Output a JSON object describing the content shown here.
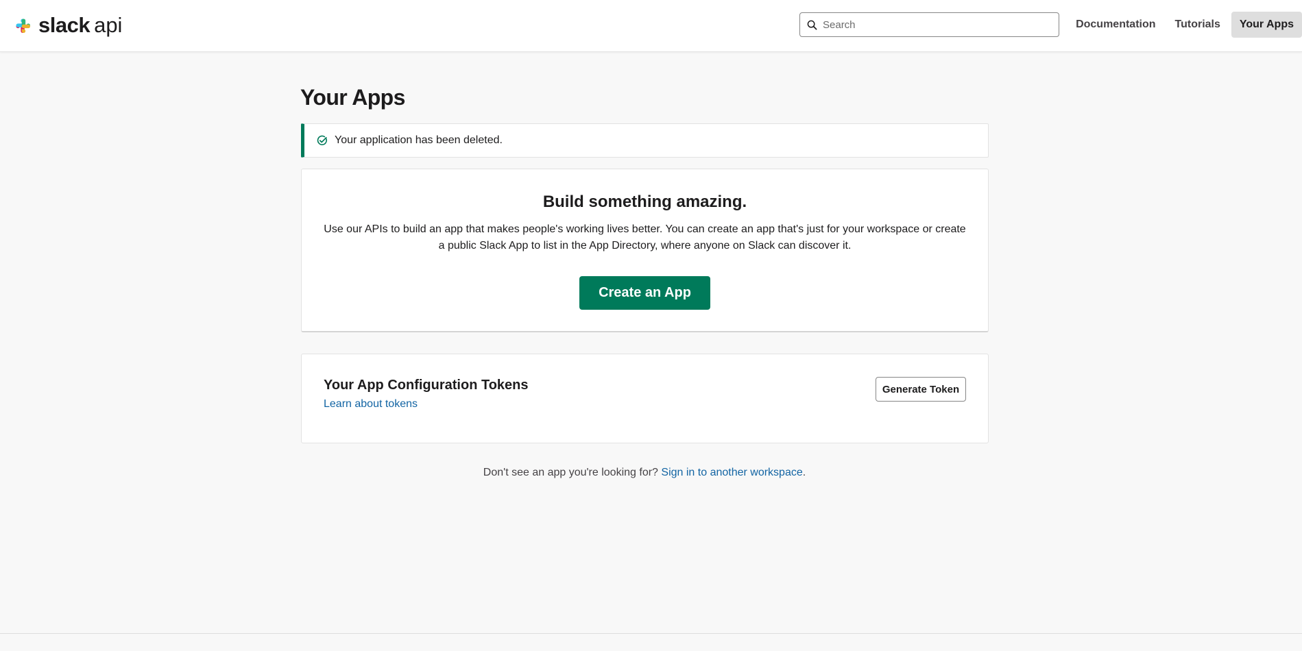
{
  "brand": {
    "name": "slack",
    "suffix": "api"
  },
  "search": {
    "placeholder": "Search",
    "value": ""
  },
  "nav": {
    "items": [
      {
        "label": "Documentation",
        "active": false
      },
      {
        "label": "Tutorials",
        "active": false
      },
      {
        "label": "Your Apps",
        "active": true
      }
    ]
  },
  "main": {
    "title": "Your Apps",
    "alert": {
      "message": "Your application has been deleted."
    },
    "build_card": {
      "heading": "Build something amazing.",
      "description": "Use our APIs to build an app that makes people's working lives better. You can create an app that's just for your workspace or create a public Slack App to list in the App Directory, where anyone on Slack can discover it.",
      "cta_label": "Create an App"
    },
    "tokens_card": {
      "heading": "Your App Configuration Tokens",
      "learn_link": "Learn about tokens",
      "button_label": "Generate Token"
    },
    "footer": {
      "prefix": "Don't see an app you're looking for?",
      "link": "Sign in to another workspace",
      "suffix": "."
    }
  },
  "colors": {
    "accent": "#007a5a",
    "link": "#1264a3",
    "background": "#f8f8f8",
    "text": "#1d1c1d"
  }
}
